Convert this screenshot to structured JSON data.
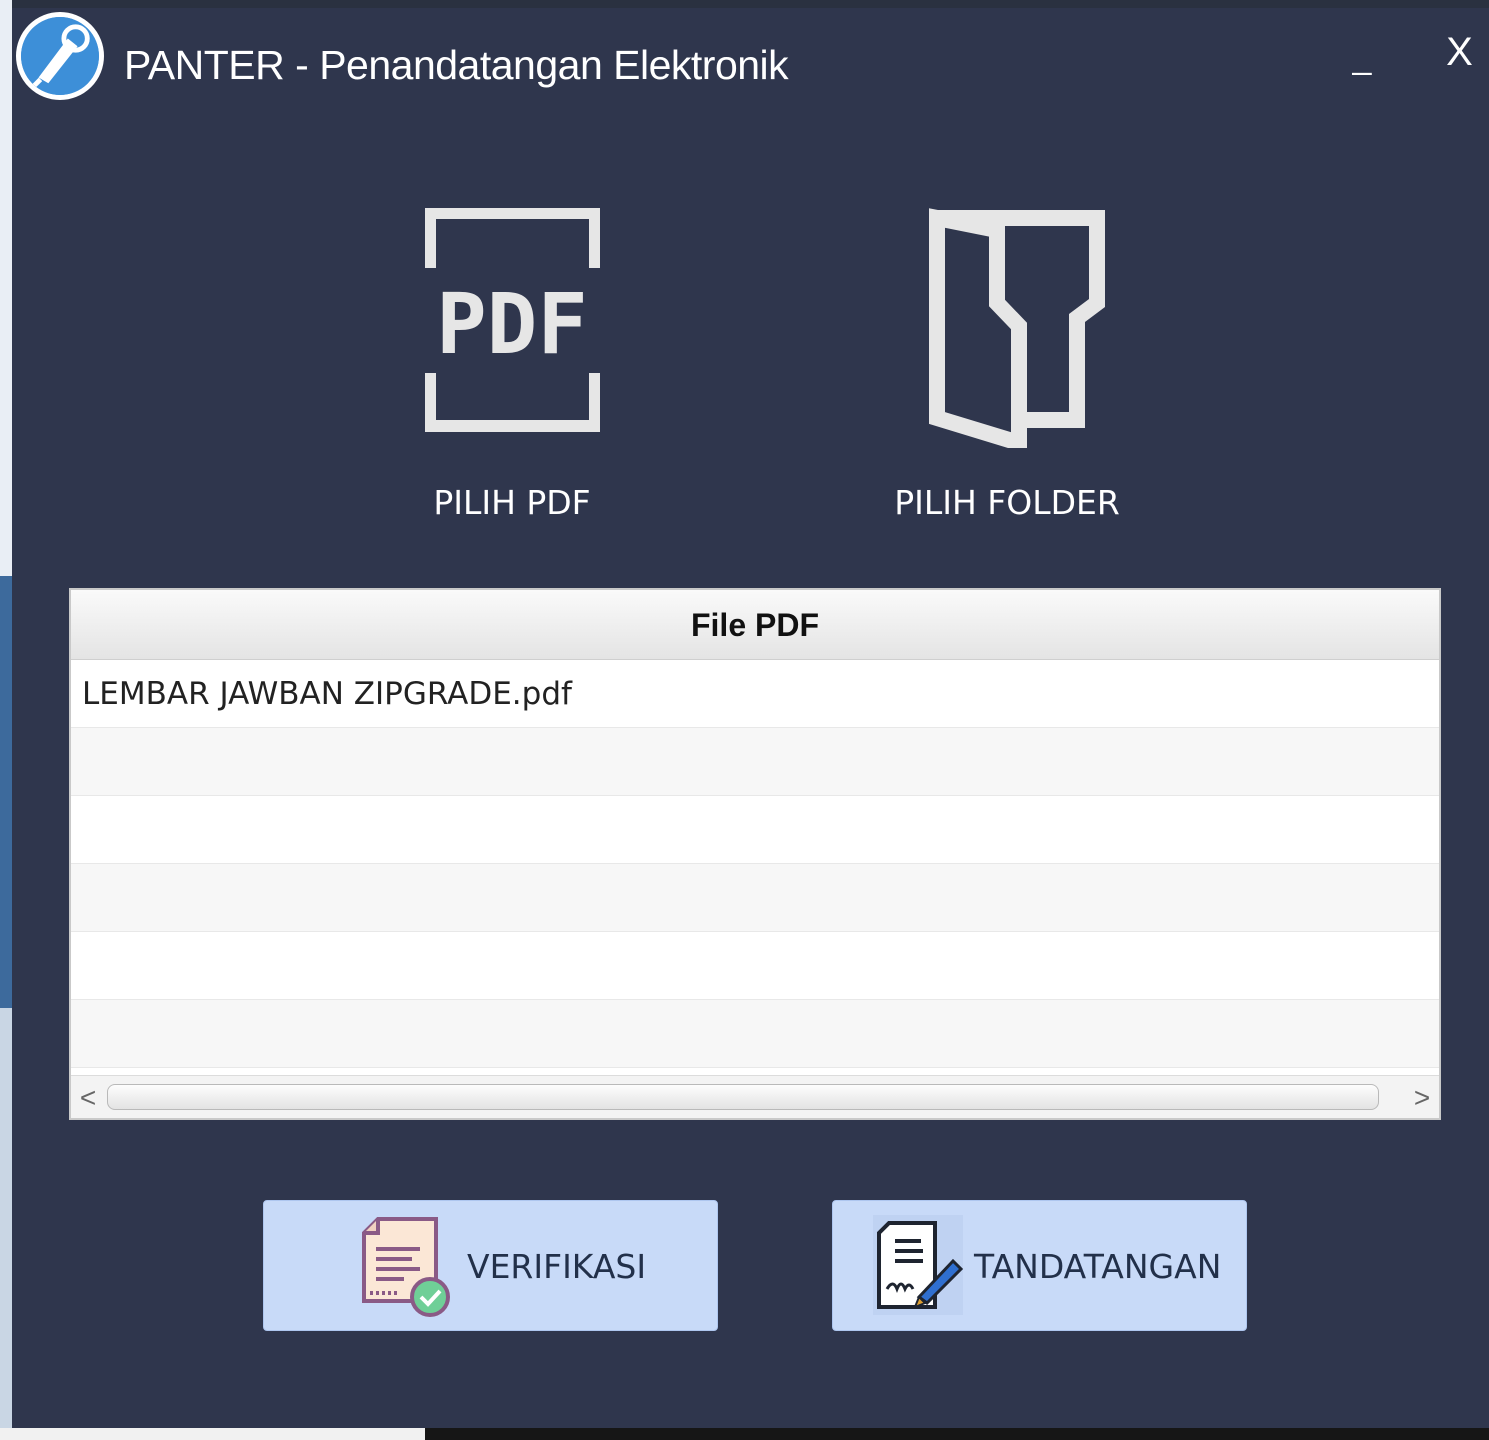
{
  "window": {
    "title": "PANTER - Penandatangan Elektronik",
    "minimize_label": "_",
    "close_label": "X"
  },
  "pickers": {
    "pdf_label": "PILIH PDF",
    "folder_label": "PILIH FOLDER"
  },
  "table": {
    "header": "File PDF",
    "rows": [
      "LEMBAR JAWBAN ZIPGRADE.pdf",
      "",
      "",
      "",
      "",
      ""
    ],
    "scroll_left": "<",
    "scroll_right": ">"
  },
  "actions": {
    "verify_label": "VERIFIKASI",
    "sign_label": "TANDATANGAN"
  },
  "colors": {
    "background": "#2f364d",
    "button": "#c8daf8",
    "logo_blue": "#3d8fd8"
  },
  "icons": {
    "logo": "app-logo-icon",
    "pdf": "pdf-icon",
    "folder": "folder-icon",
    "verify": "document-check-icon",
    "sign": "document-pen-icon"
  }
}
